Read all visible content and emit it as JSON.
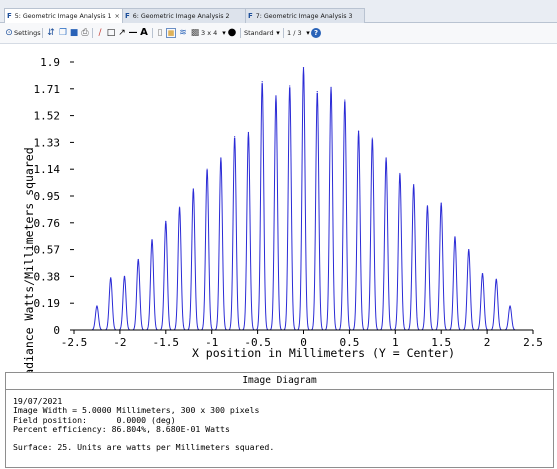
{
  "tabs": [
    {
      "label": "5: Geometric Image Analysis 1",
      "active": true,
      "close": "×"
    },
    {
      "label": "6: Geometric Image Analysis 2",
      "active": false
    },
    {
      "label": "7: Geometric Image Analysis 3",
      "active": false
    }
  ],
  "tab_icon": "F",
  "toolbar": {
    "settings_label": "Settings",
    "tools": [
      "refresh-icon",
      "copy-icon",
      "save-icon",
      "print-icon",
      "pencil-icon",
      "rectangle-icon",
      "line-icon",
      "dash-icon",
      "text-icon",
      "lock-icon",
      "table-icon",
      "layers-icon",
      "grid-icon"
    ],
    "layout_label": "3 x 4",
    "layout_extra_icon": "clock-icon",
    "standard_label": "Standard",
    "page_label": "1 / 3",
    "help_icon": "help-icon"
  },
  "chart_data": {
    "type": "line",
    "xlabel": "X position in Millimeters (Y = Center)",
    "ylabel": "Irradiance Watts/Millimeters squared",
    "xlim": [
      -2.5,
      2.5
    ],
    "ylim": [
      0,
      1.9
    ],
    "xticks": [
      "-2.5",
      "-2",
      "-1.5",
      "-1",
      "-0.5",
      "0",
      "0.5",
      "1",
      "1.5",
      "2",
      "2.5"
    ],
    "yticks": [
      "0",
      "0.19",
      "0.38",
      "0.57",
      "0.76",
      "0.95",
      "1.14",
      "1.33",
      "1.52",
      "1.71",
      "1.9"
    ],
    "line_color": "#2b2bd6",
    "series": [
      {
        "peaks_x": [
          -2.25,
          -2.1,
          -1.95,
          -1.8,
          -1.65,
          -1.5,
          -1.35,
          -1.2,
          -1.05,
          -0.9,
          -0.75,
          -0.6,
          -0.45,
          -0.3,
          -0.15,
          0,
          0.15,
          0.3,
          0.45,
          0.6,
          0.75,
          0.9,
          1.05,
          1.2,
          1.35,
          1.5,
          1.65,
          1.8,
          1.95,
          2.1,
          2.25
        ],
        "peaks_y": [
          0.17,
          0.37,
          0.38,
          0.5,
          0.64,
          0.77,
          0.87,
          1.0,
          1.14,
          1.22,
          1.37,
          1.4,
          1.76,
          1.66,
          1.73,
          1.86,
          1.69,
          1.72,
          1.63,
          1.41,
          1.36,
          1.22,
          1.11,
          1.03,
          0.88,
          0.9,
          0.66,
          0.57,
          0.4,
          0.36,
          0.17
        ]
      }
    ]
  },
  "panel": {
    "title": "Image Diagram",
    "date": "19/07/2021",
    "line1": "Image Width = 5.0000 Millimeters, 300 x 300 pixels",
    "line2": "Field position:      0.0000 (deg)",
    "line3": "Percent efficiency: 86.804%, 8.680E-01 Watts",
    "line4": "Surface: 25. Units are watts per Millimeters squared."
  }
}
